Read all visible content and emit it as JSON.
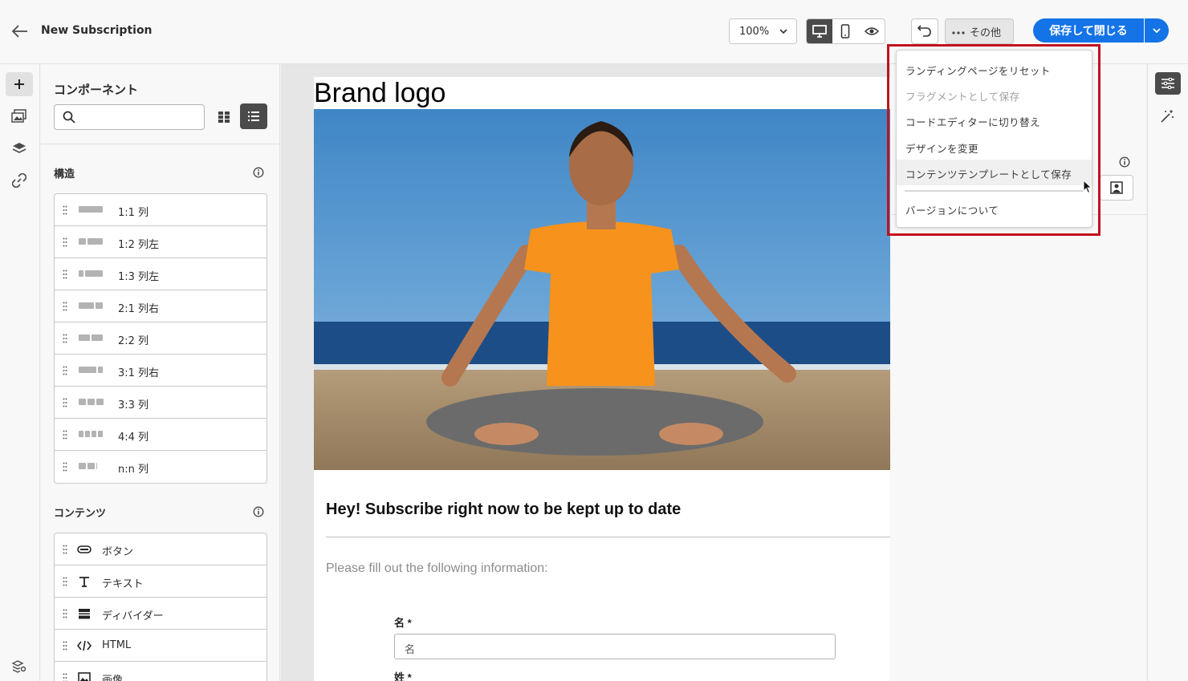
{
  "header": {
    "title": "New Subscription",
    "zoom_value": "100%",
    "more_label": "その他",
    "save_label": "保存して閉じる"
  },
  "panel": {
    "title": "コンポーネント",
    "search_placeholder": "",
    "structure_title": "構造",
    "structure_items": [
      {
        "label": "1:1 列",
        "cols": [
          1
        ]
      },
      {
        "label": "1:2 列左",
        "cols": [
          1,
          2
        ]
      },
      {
        "label": "1:3 列左",
        "cols": [
          1,
          3
        ]
      },
      {
        "label": "2:1 列右",
        "cols": [
          2,
          1
        ]
      },
      {
        "label": "2:2 列",
        "cols": [
          1,
          1
        ]
      },
      {
        "label": "3:1 列右",
        "cols": [
          3,
          1
        ]
      },
      {
        "label": "3:3 列",
        "cols": [
          1,
          1,
          1
        ]
      },
      {
        "label": "4:4 列",
        "cols": [
          1,
          1,
          1,
          1
        ]
      },
      {
        "label": "n:n 列",
        "cols": [
          1,
          1,
          0
        ]
      }
    ],
    "content_title": "コンテンツ",
    "content_items": [
      {
        "label": "ボタン",
        "icon": "button-icon"
      },
      {
        "label": "テキスト",
        "icon": "text-icon"
      },
      {
        "label": "ディバイダー",
        "icon": "divider-icon"
      },
      {
        "label": "HTML",
        "icon": "code-icon"
      },
      {
        "label": "画像",
        "icon": "image-icon"
      }
    ]
  },
  "canvas": {
    "brand_logo": "Brand logo",
    "headline": "Hey! Subscribe right now to be kept up to date",
    "subtext": "Please fill out the following information:",
    "first_name_label": "名 *",
    "first_name_placeholder": "名",
    "last_name_label": "姓 *"
  },
  "menu": {
    "items": [
      {
        "label": "ランディングページをリセット",
        "disabled": false
      },
      {
        "label": "フラグメントとして保存",
        "disabled": true
      },
      {
        "label": "コードエディターに切り替え",
        "disabled": false
      },
      {
        "label": "デザインを変更",
        "disabled": false
      },
      {
        "label": "コンテンツテンプレートとして保存",
        "disabled": false,
        "hovered": true
      },
      {
        "label": "バージョンについて",
        "disabled": false
      }
    ],
    "highlight_color": "#c1121f"
  },
  "colors": {
    "accent": "#1473e6",
    "dark_toggle": "#4b4b4b"
  }
}
